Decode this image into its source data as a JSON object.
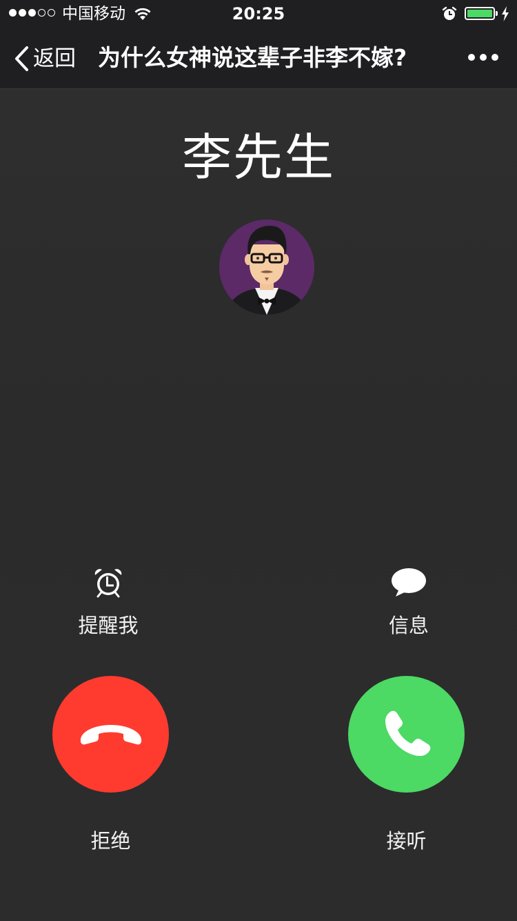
{
  "status_bar": {
    "carrier": "中国移动",
    "time": "20:25",
    "signal_bars_filled": 3,
    "signal_bars_total": 5,
    "battery_level": 1.0,
    "charging": true,
    "battery_color": "#4cd964"
  },
  "nav": {
    "back_label": "返回",
    "title": "为什么女神说这辈子非李不嫁?",
    "more_icon": "more-dots-icon"
  },
  "caller": {
    "name": "李先生",
    "avatar_icon": "caller-avatar"
  },
  "actions": {
    "remind_label": "提醒我",
    "remind_icon": "alarm-clock-icon",
    "message_label": "信息",
    "message_icon": "chat-bubble-icon"
  },
  "call_buttons": {
    "decline_label": "拒绝",
    "decline_color": "#ff3b30",
    "accept_label": "接听",
    "accept_color": "#4cd964"
  }
}
